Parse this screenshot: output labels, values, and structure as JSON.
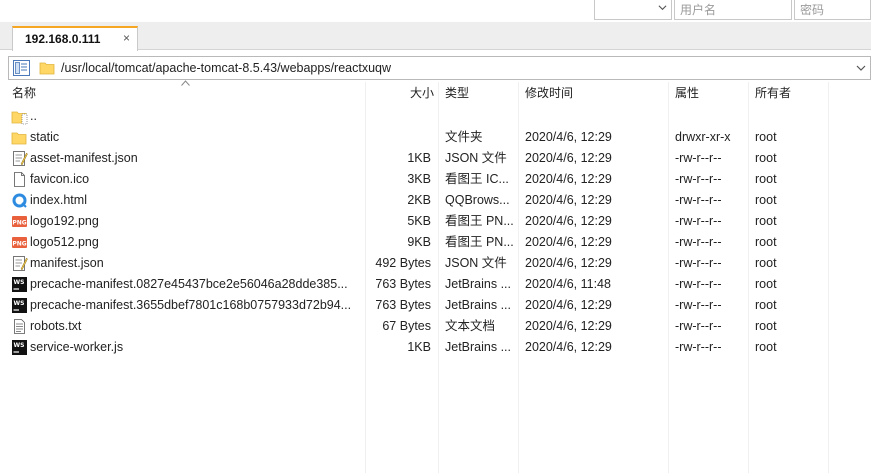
{
  "login": {
    "username_placeholder": "用户名",
    "password_placeholder": "密码"
  },
  "tab": {
    "title": "192.168.0.111",
    "close": "×"
  },
  "path": {
    "value": "/usr/local/tomcat/apache-tomcat-8.5.43/webapps/reactxuqw"
  },
  "columns": {
    "name": "名称",
    "size": "大小",
    "type": "类型",
    "modified": "修改时间",
    "attributes": "属性",
    "owner": "所有者"
  },
  "files": [
    {
      "icon": "folder-up-icon",
      "name": "..",
      "size": "",
      "type": "",
      "modified": "",
      "attributes": "",
      "owner": ""
    },
    {
      "icon": "folder-icon",
      "name": "static",
      "size": "",
      "type": "文件夹",
      "modified": "2020/4/6, 12:29",
      "attributes": "drwxr-xr-x",
      "owner": "root"
    },
    {
      "icon": "json-file-icon",
      "name": "asset-manifest.json",
      "size": "1KB",
      "type": "JSON 文件",
      "modified": "2020/4/6, 12:29",
      "attributes": "-rw-r--r--",
      "owner": "root"
    },
    {
      "icon": "blank-file-icon",
      "name": "favicon.ico",
      "size": "3KB",
      "type": "看图王 IC...",
      "modified": "2020/4/6, 12:29",
      "attributes": "-rw-r--r--",
      "owner": "root"
    },
    {
      "icon": "browser-file-icon",
      "name": "index.html",
      "size": "2KB",
      "type": "QQBrows...",
      "modified": "2020/4/6, 12:29",
      "attributes": "-rw-r--r--",
      "owner": "root"
    },
    {
      "icon": "png-file-icon",
      "name": "logo192.png",
      "size": "5KB",
      "type": "看图王 PN...",
      "modified": "2020/4/6, 12:29",
      "attributes": "-rw-r--r--",
      "owner": "root"
    },
    {
      "icon": "png-file-icon",
      "name": "logo512.png",
      "size": "9KB",
      "type": "看图王 PN...",
      "modified": "2020/4/6, 12:29",
      "attributes": "-rw-r--r--",
      "owner": "root"
    },
    {
      "icon": "json-file-icon",
      "name": "manifest.json",
      "size": "492 Bytes",
      "type": "JSON 文件",
      "modified": "2020/4/6, 12:29",
      "attributes": "-rw-r--r--",
      "owner": "root"
    },
    {
      "icon": "webstorm-file-icon",
      "name": "precache-manifest.0827e45437bce2e56046a28dde385...",
      "size": "763 Bytes",
      "type": "JetBrains ...",
      "modified": "2020/4/6, 11:48",
      "attributes": "-rw-r--r--",
      "owner": "root"
    },
    {
      "icon": "webstorm-file-icon",
      "name": "precache-manifest.3655dbef7801c168b0757933d72b94...",
      "size": "763 Bytes",
      "type": "JetBrains ...",
      "modified": "2020/4/6, 12:29",
      "attributes": "-rw-r--r--",
      "owner": "root"
    },
    {
      "icon": "text-file-icon",
      "name": "robots.txt",
      "size": "67 Bytes",
      "type": "文本文档",
      "modified": "2020/4/6, 12:29",
      "attributes": "-rw-r--r--",
      "owner": "root"
    },
    {
      "icon": "webstorm-file-icon",
      "name": "service-worker.js",
      "size": "1KB",
      "type": "JetBrains ...",
      "modified": "2020/4/6, 12:29",
      "attributes": "-rw-r--r--",
      "owner": "root"
    }
  ]
}
